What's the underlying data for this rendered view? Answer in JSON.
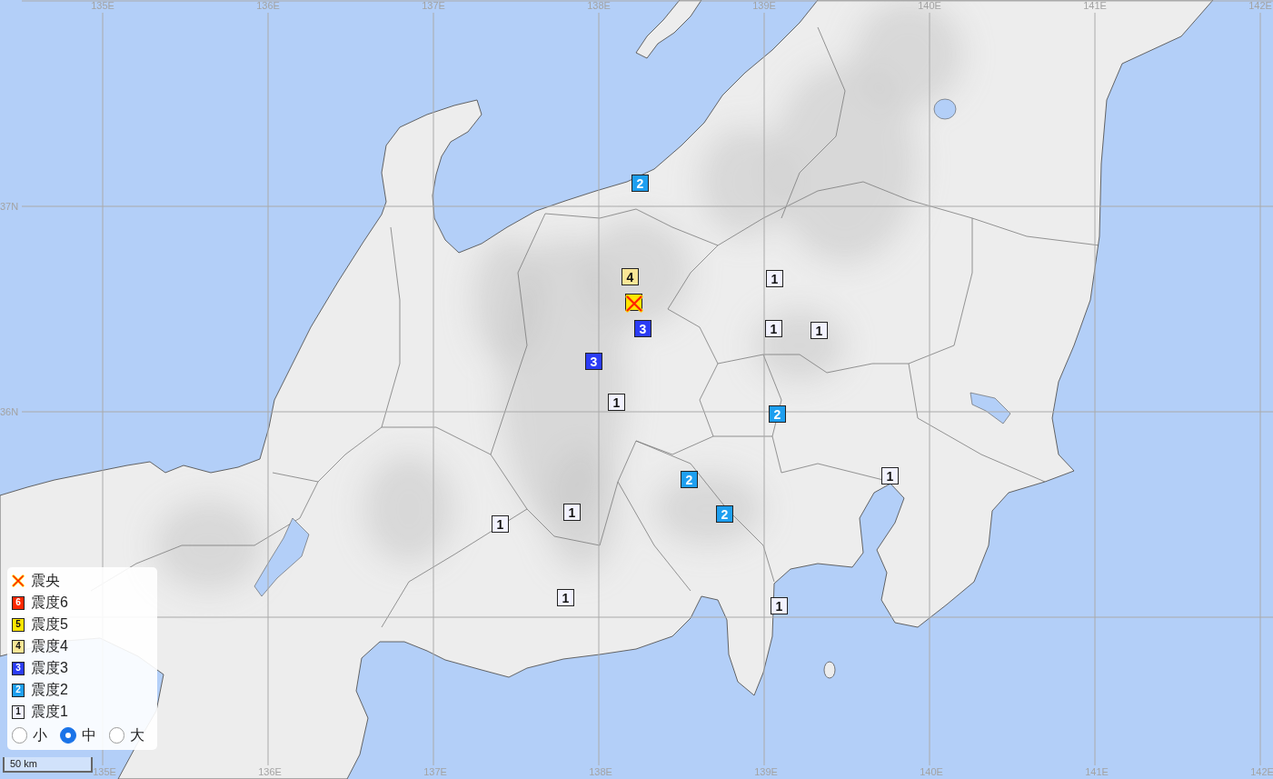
{
  "grid_labels": {
    "top": [
      "135E",
      "136E",
      "137E",
      "138E",
      "139E",
      "140E",
      "141E",
      "142E"
    ],
    "left": [
      "37N",
      "36N"
    ],
    "bottom": [
      "135E",
      "136E",
      "137E",
      "138E",
      "139E",
      "140E",
      "141E",
      "142E"
    ]
  },
  "markers": [
    {
      "label": "2",
      "color": "#1e9ff0"
    },
    {
      "label": "4",
      "color": "#fae696"
    },
    {
      "color": "#ffe600"
    },
    {
      "label": "3",
      "color": "#2b3cf5"
    },
    {
      "label": "1",
      "color": "#f2f2ff"
    },
    {
      "label": "1",
      "color": "#f2f2ff"
    },
    {
      "label": "1",
      "color": "#f2f2ff"
    },
    {
      "label": "3",
      "color": "#2b3cf5"
    },
    {
      "label": "1",
      "color": "#f2f2ff"
    },
    {
      "label": "2",
      "color": "#1e9ff0"
    },
    {
      "label": "1",
      "color": "#f2f2ff"
    },
    {
      "label": "2",
      "color": "#1e9ff0"
    },
    {
      "label": "2",
      "color": "#1e9ff0"
    },
    {
      "label": "1",
      "color": "#f2f2ff"
    },
    {
      "label": "1",
      "color": "#f2f2ff"
    },
    {
      "label": "1",
      "color": "#f2f2ff"
    },
    {
      "label": "1",
      "color": "#f2f2ff"
    }
  ],
  "legend": {
    "items": [
      {
        "kind": "epicenter",
        "label": "震央"
      },
      {
        "kind": "intensity",
        "swatch": "6",
        "label": "震度6",
        "color": "#ff2800"
      },
      {
        "kind": "intensity",
        "swatch": "5",
        "label": "震度5",
        "color": "#ffe600"
      },
      {
        "kind": "intensity",
        "swatch": "4",
        "label": "震度4",
        "color": "#fae696"
      },
      {
        "kind": "intensity",
        "swatch": "3",
        "label": "震度3",
        "color": "#2b3cf5"
      },
      {
        "kind": "intensity",
        "swatch": "2",
        "label": "震度2",
        "color": "#1e9ff0"
      },
      {
        "kind": "intensity",
        "swatch": "1",
        "label": "震度1",
        "color": "#f2f2ff"
      }
    ],
    "size_options": [
      {
        "label": "小",
        "selected": false
      },
      {
        "label": "中",
        "selected": true
      },
      {
        "label": "大",
        "selected": false
      }
    ]
  },
  "scale_bar": {
    "label": "50 km"
  }
}
